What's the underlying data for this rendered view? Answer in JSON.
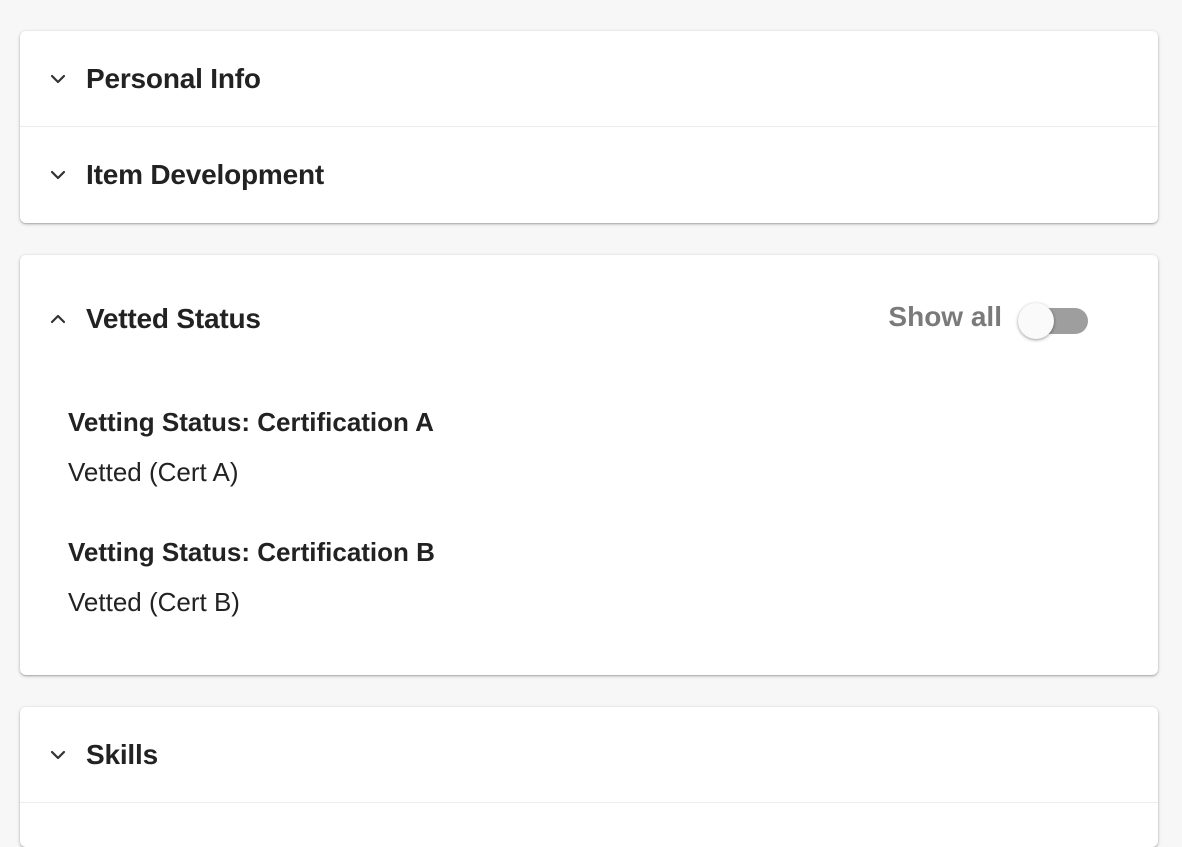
{
  "sections": {
    "personal_info": {
      "title": "Personal Info",
      "expanded": false,
      "icon": "chevron-down-icon"
    },
    "item_development": {
      "title": "Item Development",
      "expanded": false,
      "icon": "chevron-down-icon"
    },
    "vetted_status": {
      "title": "Vetted Status",
      "expanded": true,
      "icon": "chevron-up-icon",
      "toggle": {
        "label": "Show all",
        "on": false
      },
      "fields": [
        {
          "label": "Vetting Status: Certification A",
          "value": "Vetted (Cert A)"
        },
        {
          "label": "Vetting Status: Certification B",
          "value": "Vetted (Cert B)"
        }
      ]
    },
    "skills": {
      "title": "Skills",
      "expanded": false,
      "icon": "chevron-down-icon"
    }
  },
  "colors": {
    "background": "#f7f7f7",
    "panel": "#ffffff",
    "text": "#222222",
    "muted_text": "#7a7a7a",
    "switch_track_off": "#9e9e9e"
  }
}
